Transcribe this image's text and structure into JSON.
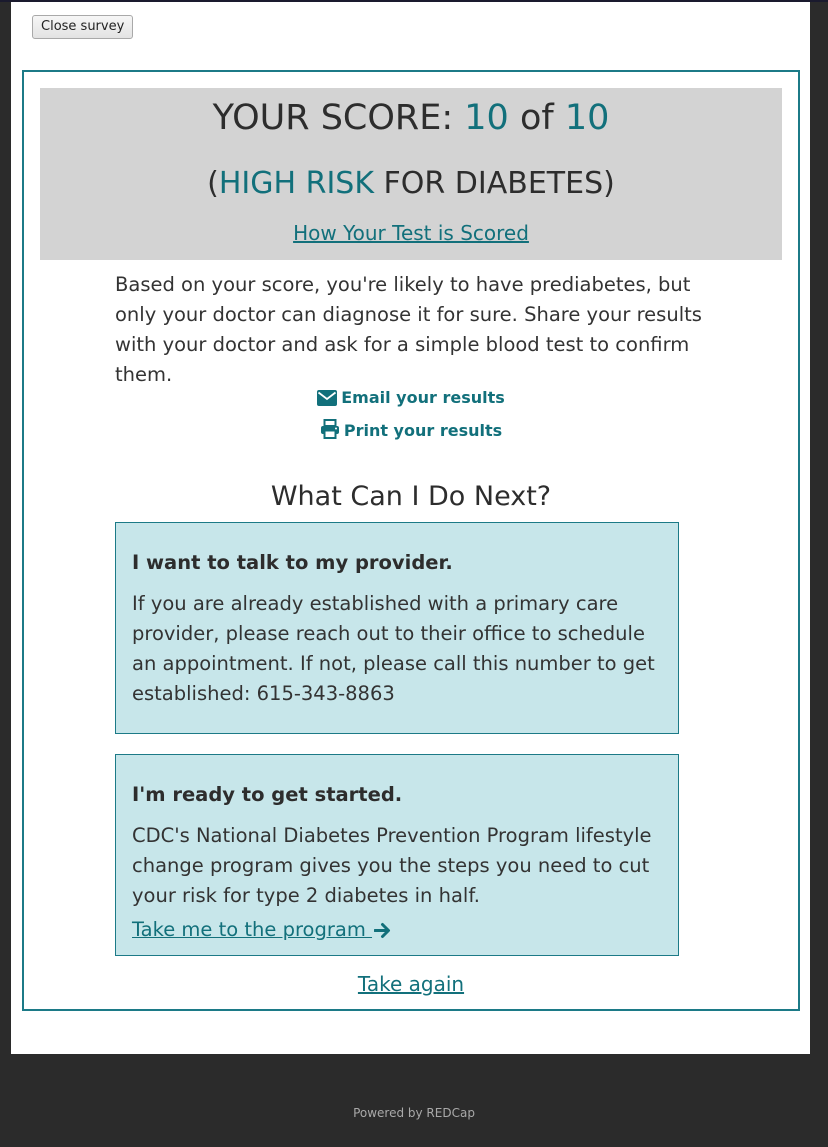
{
  "toolbar": {
    "close_label": "Close survey"
  },
  "score": {
    "prefix": "YOUR SCORE: ",
    "value": "10",
    "of": " of ",
    "max": "10"
  },
  "risk": {
    "open": "(",
    "level": "HIGH RISK",
    "suffix": " FOR DIABETES)"
  },
  "scored_link": "How Your Test is Scored",
  "intro": "Based on your score, you're likely to have prediabetes, but only your doctor can diagnose it for sure. Share your results with your doctor and ask for a simple blood test to confirm them.",
  "actions": {
    "email_label": "Email your results",
    "email_icon": "envelope-icon",
    "print_label": "Print your results",
    "print_icon": "printer-icon"
  },
  "next_heading": "What Can I Do Next?",
  "cards": [
    {
      "title": "I want to talk to my provider.",
      "text": "If you are already established with a primary care provider, please reach out to their office to schedule an appointment. If not, please call this number to get established: 615-343-8863"
    },
    {
      "title": "I'm ready to get started.",
      "text": "CDC's National Diabetes Prevention Program lifestyle change program gives you the steps you need to cut your risk for type 2 diabetes in half.",
      "link": "Take me to the program ",
      "link_icon": "arrow-right-icon"
    }
  ],
  "take_again": "Take again",
  "footer": "Powered by REDCap",
  "colors": {
    "accent": "#12707b",
    "card_bg": "#c7e6ea",
    "score_panel_bg": "#d3d3d3",
    "page_bg": "#2b2b2b"
  }
}
